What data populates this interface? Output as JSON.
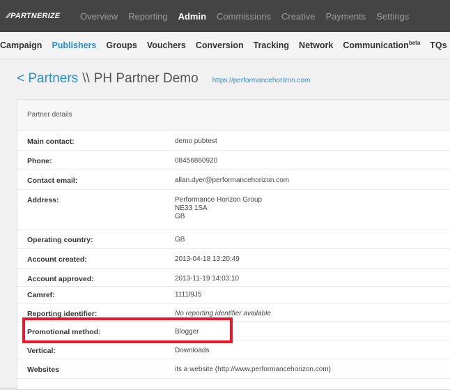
{
  "brand": {
    "logo_text": "PARTNERIZE",
    "logo_mark": "⁄⁄",
    "colors": {
      "topbar": "#444444",
      "link": "#2a8ed2",
      "highlight": "#e8192c"
    }
  },
  "topnav": {
    "items": [
      "Overview",
      "Reporting",
      "Admin",
      "Commissions",
      "Creative",
      "Payments",
      "Settings"
    ],
    "active": "Admin"
  },
  "subnav": {
    "items": [
      "Campaign",
      "Publishers",
      "Groups",
      "Vouchers",
      "Conversion",
      "Tracking",
      "Network",
      "Communication",
      "TQs"
    ],
    "communication_sup": "beta",
    "active": "Publishers"
  },
  "heading": {
    "back_link": "< Partners",
    "separator": "\\\\",
    "partner_name": "PH Partner Demo",
    "site_link": "https://performancehorizon.com"
  },
  "panel": {
    "title": "Partner details",
    "rows": [
      {
        "label": "Main contact:",
        "value": "demo pubtest"
      },
      {
        "label": "Phone:",
        "value": "08456860920"
      },
      {
        "label": "Contact email:",
        "value": "allan.dyer@performancehorizon.com"
      },
      {
        "label": "Address:",
        "value_lines": [
          "Performance Horizon Group",
          "NE33 1SA",
          "GB"
        ]
      },
      {
        "label": "Operating country:",
        "value": "GB"
      },
      {
        "label": "Account created:",
        "value": "2013-04-18 13:20:49"
      },
      {
        "label": "Account approved:",
        "value": "2013-11-19 14:03:10"
      },
      {
        "label": "Camref:",
        "value": "1111l9J5"
      },
      {
        "label": "Reporting identifier:",
        "value": "No reporting identifier available"
      },
      {
        "label": "Promotional method:",
        "value": "Blogger"
      },
      {
        "label": "Vertical:",
        "value": "Downloads"
      },
      {
        "label": "Websites",
        "value": "its a website (http://www.performancehorizon.com)"
      }
    ]
  }
}
